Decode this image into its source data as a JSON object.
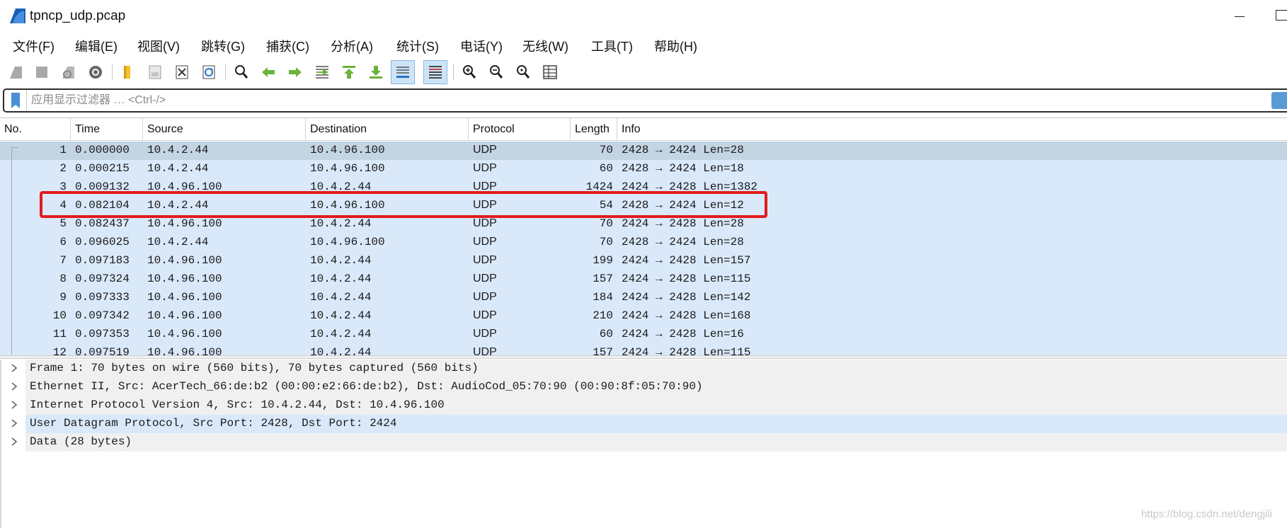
{
  "window": {
    "title": "tpncp_udp.pcap",
    "icon": "wireshark-fin-icon"
  },
  "menu": [
    "文件(F)",
    "编辑(E)",
    "视图(V)",
    "跳转(G)",
    "捕获(C)",
    "分析(A)",
    "统计(S)",
    "电话(Y)",
    "无线(W)",
    "工具(T)",
    "帮助(H)"
  ],
  "toolbar": {
    "buttons": [
      "start-capture-icon",
      "stop-capture-icon",
      "restart-capture-icon",
      "capture-options-icon",
      "open-file-icon",
      "save-file-icon",
      "close-file-icon",
      "reload-file-icon",
      "find-packet-icon",
      "go-back-icon",
      "go-forward-icon",
      "go-to-packet-icon",
      "go-first-icon",
      "go-last-icon",
      "auto-scroll-icon",
      "colorize-icon",
      "zoom-in-icon",
      "zoom-out-icon",
      "zoom-normal-icon",
      "resize-columns-icon"
    ],
    "active": [
      "auto-scroll-icon",
      "colorize-icon"
    ]
  },
  "filter": {
    "placeholder": "应用显示过滤器 … <Ctrl-/>",
    "value": ""
  },
  "packet_list": {
    "columns": [
      "No.",
      "Time",
      "Source",
      "Destination",
      "Protocol",
      "Length",
      "Info"
    ],
    "rows": [
      {
        "no": "1",
        "time": "0.000000",
        "src": "10.4.2.44",
        "dst": "10.4.96.100",
        "proto": "UDP",
        "len": "70",
        "info": "2428 → 2424 Len=28",
        "selected": true
      },
      {
        "no": "2",
        "time": "0.000215",
        "src": "10.4.2.44",
        "dst": "10.4.96.100",
        "proto": "UDP",
        "len": "60",
        "info": "2428 → 2424 Len=18"
      },
      {
        "no": "3",
        "time": "0.009132",
        "src": "10.4.96.100",
        "dst": "10.4.2.44",
        "proto": "UDP",
        "len": "1424",
        "info": "2424 → 2428 Len=1382"
      },
      {
        "no": "4",
        "time": "0.082104",
        "src": "10.4.2.44",
        "dst": "10.4.96.100",
        "proto": "UDP",
        "len": "54",
        "info": "2428 → 2424 Len=12",
        "highlighted": true
      },
      {
        "no": "5",
        "time": "0.082437",
        "src": "10.4.96.100",
        "dst": "10.4.2.44",
        "proto": "UDP",
        "len": "70",
        "info": "2424 → 2428 Len=28"
      },
      {
        "no": "6",
        "time": "0.096025",
        "src": "10.4.2.44",
        "dst": "10.4.96.100",
        "proto": "UDP",
        "len": "70",
        "info": "2428 → 2424 Len=28"
      },
      {
        "no": "7",
        "time": "0.097183",
        "src": "10.4.96.100",
        "dst": "10.4.2.44",
        "proto": "UDP",
        "len": "199",
        "info": "2424 → 2428 Len=157"
      },
      {
        "no": "8",
        "time": "0.097324",
        "src": "10.4.96.100",
        "dst": "10.4.2.44",
        "proto": "UDP",
        "len": "157",
        "info": "2424 → 2428 Len=115"
      },
      {
        "no": "9",
        "time": "0.097333",
        "src": "10.4.96.100",
        "dst": "10.4.2.44",
        "proto": "UDP",
        "len": "184",
        "info": "2424 → 2428 Len=142"
      },
      {
        "no": "10",
        "time": "0.097342",
        "src": "10.4.96.100",
        "dst": "10.4.2.44",
        "proto": "UDP",
        "len": "210",
        "info": "2424 → 2428 Len=168"
      },
      {
        "no": "11",
        "time": "0.097353",
        "src": "10.4.96.100",
        "dst": "10.4.2.44",
        "proto": "UDP",
        "len": "60",
        "info": "2424 → 2428 Len=16"
      },
      {
        "no": "12",
        "time": "0.097519",
        "src": "10.4.96.100",
        "dst": "10.4.2.44",
        "proto": "UDP",
        "len": "157",
        "info": "2424 → 2428 Len=115"
      }
    ]
  },
  "details": [
    {
      "text": "Frame 1: 70 bytes on wire (560 bits), 70 bytes captured (560 bits)"
    },
    {
      "text": "Ethernet II, Src: AcerTech_66:de:b2 (00:00:e2:66:de:b2), Dst: AudioCod_05:70:90 (00:90:8f:05:70:90)"
    },
    {
      "text": "Internet Protocol Version 4, Src: 10.4.2.44, Dst: 10.4.96.100"
    },
    {
      "text": "User Datagram Protocol, Src Port: 2428, Dst Port: 2424",
      "selected": true
    },
    {
      "text": "Data (28 bytes)"
    }
  ],
  "watermark": "https://blog.csdn.net/dengjili",
  "colors": {
    "row_bg": "#dae9fa",
    "row_selected": "#c3d4e3",
    "highlight_box": "#e21b1b"
  }
}
